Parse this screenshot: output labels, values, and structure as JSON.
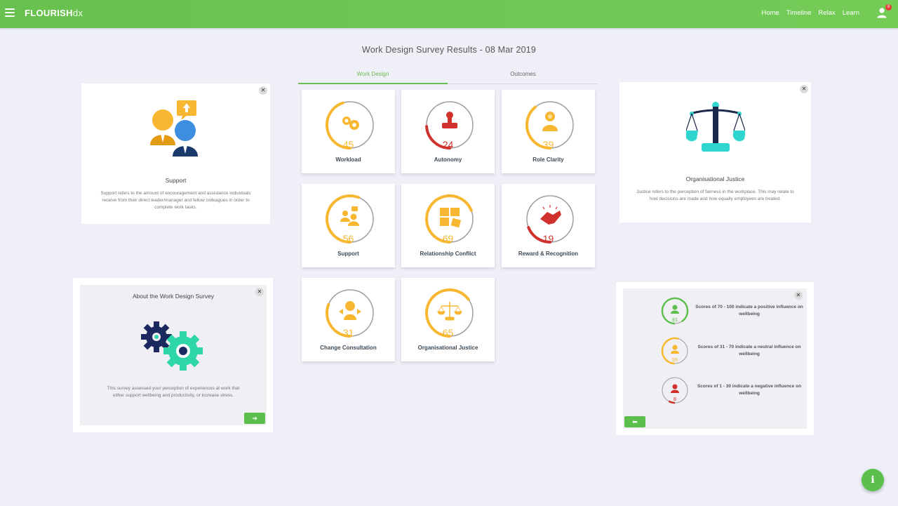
{
  "brand": {
    "bold": "FLOURISH",
    "light": "dx"
  },
  "nav": [
    "Home",
    "Timeline",
    "Relax",
    "Learn"
  ],
  "notification_count": "8",
  "page_title": "Work Design Survey Results - 08 Mar 2019",
  "tabs": {
    "active": "Work Design",
    "inactive": "Outcomes"
  },
  "colors": {
    "green": "#5cbf4b",
    "orange": "#f7b731",
    "red": "#d0312d",
    "grey": "#9e9e9e"
  },
  "cards": [
    {
      "label": "Workload",
      "score": 45,
      "icon": "gears-icon"
    },
    {
      "label": "Autonomy",
      "score": 24,
      "icon": "stamp-icon"
    },
    {
      "label": "Role Clarity",
      "score": 39,
      "icon": "person-idea-icon"
    },
    {
      "label": "Support",
      "score": 56,
      "icon": "support-people-icon"
    },
    {
      "label": "Relationship Conflict",
      "score": 69,
      "icon": "puzzle-icon"
    },
    {
      "label": "Reward & Recognition",
      "score": 19,
      "icon": "handshake-icon"
    },
    {
      "label": "Change Consultation",
      "score": 31,
      "icon": "person-arrows-icon"
    },
    {
      "label": "Organisational Justice",
      "score": 65,
      "icon": "scales-icon"
    }
  ],
  "support_panel": {
    "title": "Support",
    "description": "Support refers to the amount of encouragement and assistance individuals receive from their direct leader/manager and fellow colleagues in order to complete work tasks."
  },
  "justice_panel": {
    "title": "Organisational Justice",
    "description": "Justice refers to the perception of fairness in the workplace. This may relate to how decisions are made and how equally employees are treated."
  },
  "about_panel": {
    "title": "About the Work Design Survey",
    "description": "This survey assessed your perception of experiences at work that either support wellbeing and productivity, or increase stress."
  },
  "legend": [
    {
      "score": 91,
      "text": "Scores of 70 - 100 indicate a positive influence on wellbeing",
      "color": "#5cbf4b"
    },
    {
      "score": 55,
      "text": "Scores of 31 - 70 indicate a neutral influence on wellbeing",
      "color": "#f7b731"
    },
    {
      "score": 8,
      "text": "Scores of 1 - 30 indicate a negative influence on wellbeing",
      "color": "#d0312d"
    }
  ]
}
